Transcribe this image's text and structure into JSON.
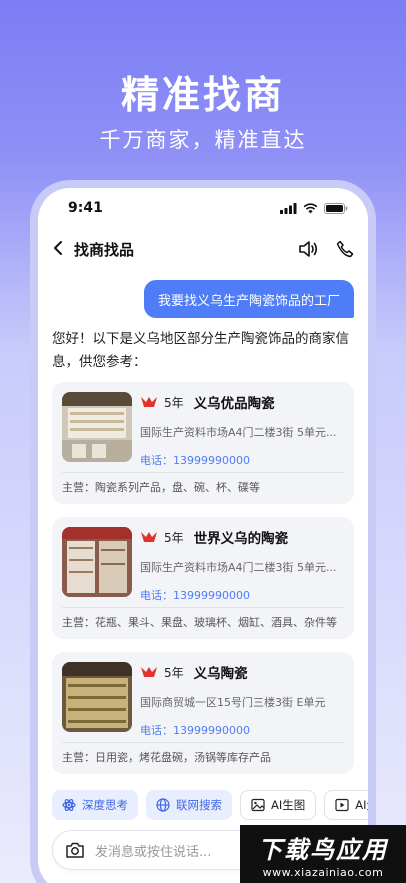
{
  "hero": {
    "title": "精准找商",
    "subtitle": "千万商家，精准直达"
  },
  "status_bar": {
    "time": "9:41"
  },
  "nav": {
    "title": "找商找品"
  },
  "chat": {
    "user_message": "我要找义乌生产陶瓷饰品的工厂",
    "reply_line1": "您好！以下是义乌地区部分生产陶瓷饰品的商家信",
    "reply_line2": "息，供您参考："
  },
  "merchants": [
    {
      "years": "5年",
      "name": "义乌优品陶瓷",
      "address": "国际生产资料市场A4门二楼3街 5单元...",
      "phone": "电话：13999990000",
      "main_business": "主营：陶瓷系列产品，盘、碗、杯、碟等"
    },
    {
      "years": "5年",
      "name": "世界义乌的陶瓷",
      "address": "国际生产资料市场A4门二楼3街 5单元...",
      "phone": "电话：13999990000",
      "main_business": "主营：花瓶、果斗、果盘、玻璃杯、烟缸、酒具、杂件等"
    },
    {
      "years": "5年",
      "name": "义乌陶瓷",
      "address": "国际商贸城一区15号门三楼3街 E单元",
      "phone": "电话：13999990000",
      "main_business": "主营：日用瓷，烤花盘碗，汤锅等库存产品"
    }
  ],
  "chips": {
    "deep_think": "深度思考",
    "web_search": "联网搜索",
    "ai_image": "AI生图",
    "ai_video": "AI生视频"
  },
  "input": {
    "placeholder": "发消息或按住说话..."
  },
  "watermark": {
    "title": "下载鸟应用",
    "url": "www.xiazainiao.com"
  },
  "colors": {
    "accent": "#4f7cf7",
    "background_top": "#7c7df4"
  },
  "icons": [
    "back-chevron-icon",
    "speaker-icon",
    "phone-icon",
    "atom-icon",
    "globe-icon",
    "image-icon",
    "video-icon",
    "camera-icon",
    "signal-icon",
    "wifi-icon",
    "battery-icon",
    "crown-badge-icon"
  ]
}
